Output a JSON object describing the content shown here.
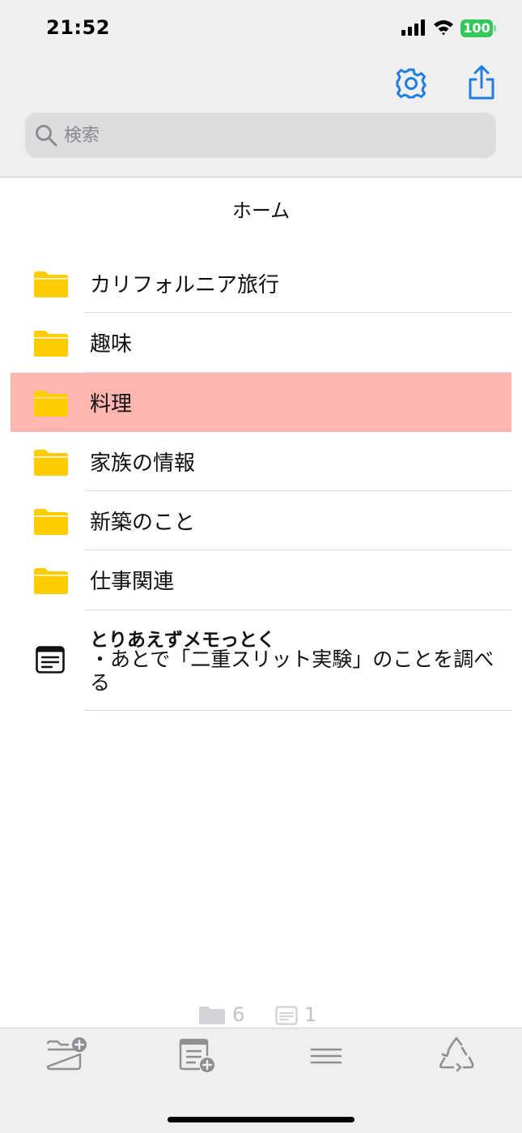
{
  "status_bar": {
    "time": "21:52",
    "battery": "100"
  },
  "search": {
    "placeholder": "検索",
    "value": ""
  },
  "page": {
    "title": "ホーム"
  },
  "folders": [
    {
      "label": "カリフォルニア旅行",
      "highlighted": false
    },
    {
      "label": "趣味",
      "highlighted": false
    },
    {
      "label": "料理",
      "highlighted": true
    },
    {
      "label": "家族の情報",
      "highlighted": false
    },
    {
      "label": "新築のこと",
      "highlighted": false
    },
    {
      "label": "仕事関連",
      "highlighted": false
    }
  ],
  "memo": {
    "title": "とりあえずメモっとく",
    "body": "・あとで「二重スリット実験」のことを調べる"
  },
  "counts": {
    "folders": "6",
    "memos": "1"
  },
  "icons": {
    "settings": "gear-icon",
    "share": "share-icon",
    "search": "search-icon",
    "folder": "folder-icon",
    "memo": "memo-icon",
    "new_folder": "new-folder-icon",
    "new_memo": "new-memo-icon",
    "menu": "menu-lines-icon",
    "trash": "recycle-icon"
  },
  "colors": {
    "accent": "#1e7fe0",
    "folder": "#ffcc00",
    "highlight": "#ffb6b1",
    "battery": "#34c759",
    "tab_icon": "#8e8e93"
  }
}
